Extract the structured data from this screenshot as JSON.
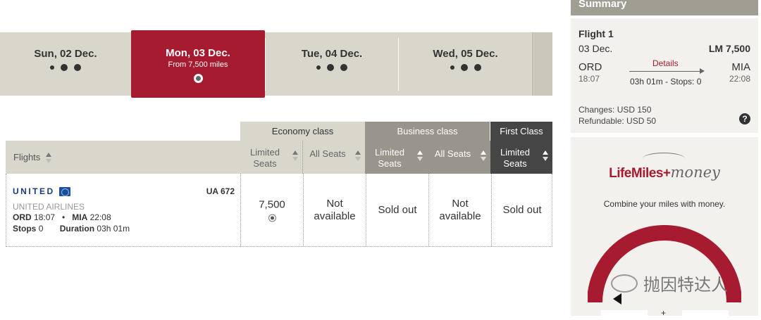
{
  "date_tabs": [
    {
      "label": "Sun, 02 Dec.",
      "selected": false
    },
    {
      "label": "Mon, 03 Dec.",
      "sublabel": "From 7,500 miles",
      "selected": true
    },
    {
      "label": "Tue, 04 Dec.",
      "selected": false
    },
    {
      "label": "Wed, 05 Dec.",
      "selected": false
    }
  ],
  "classes": {
    "economy": "Economy class",
    "business": "Business class",
    "first": "First Class"
  },
  "columns": {
    "flights": "Flights",
    "eco_limited": "Limited Seats",
    "eco_all": "All Seats",
    "bus_limited": "Limited Seats",
    "bus_all": "All Seats",
    "first_limited": "Limited Seats"
  },
  "flight": {
    "logo_text": "UNITED",
    "number": "UA 672",
    "airline": "UNITED AIRLINES",
    "origin": "ORD",
    "dep_time": "18:07",
    "dest": "MIA",
    "arr_time": "22:08",
    "stops_label": "Stops",
    "stops": "0",
    "duration_label": "Duration",
    "duration": "03h 01m"
  },
  "fares": {
    "eco_limited": "7,500",
    "eco_all": "Not available",
    "bus_limited": "Sold out",
    "bus_all": "Not available",
    "first_limited": "Sold out"
  },
  "summary": {
    "header": "Summary",
    "title": "Flight 1",
    "date": "03 Dec.",
    "price": "LM 7,500",
    "origin": "ORD",
    "dep_time": "18:07",
    "dest": "MIA",
    "arr_time": "22:08",
    "details": "Details",
    "duration": "03h 01m - Stops: 0",
    "changes": "Changes: USD 150",
    "refundable": "Refundable: USD 50",
    "help": "?"
  },
  "lifemiles": {
    "logo_part1": "LifeMiles",
    "logo_plus": "+",
    "logo_part2": "money",
    "tagline": "Combine your miles with money.",
    "gauge_level": 1.0
  },
  "watermark": "抛因特达人",
  "colors": {
    "brand_red": "#a61b2f",
    "tan": "#d9d6cc",
    "business": "#9a958c",
    "first": "#454545"
  }
}
